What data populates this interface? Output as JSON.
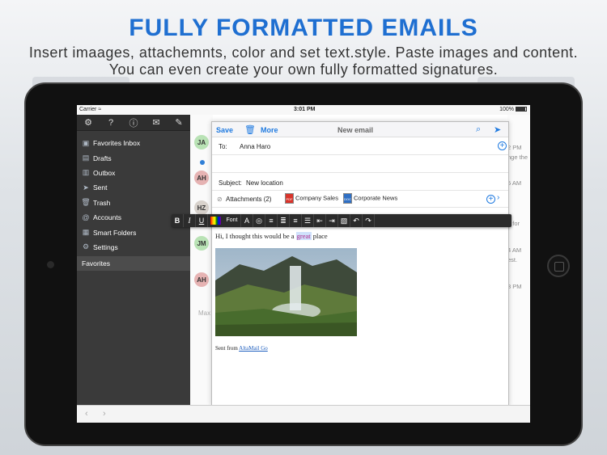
{
  "headline": "FULLY FORMATTED EMAILS",
  "subline": "Insert imaages, attachemnts, color and set text.style. Paste images and content. You can even create your own fully formatted signatures.",
  "status": {
    "carrier": "Carrier",
    "time": "3:01 PM",
    "battery": "100%"
  },
  "sidebar": {
    "toolbar_icons": [
      "gear-icon",
      "help-icon",
      "info-icon",
      "mail-icon",
      "compose-icon"
    ],
    "items": [
      {
        "label": "Favorites Inbox",
        "icon": "inbox-icon"
      },
      {
        "label": "Drafts",
        "icon": "drafts-icon"
      },
      {
        "label": "Outbox",
        "icon": "outbox-icon"
      },
      {
        "label": "Sent",
        "icon": "sent-icon"
      },
      {
        "label": "Trash",
        "icon": "trash-icon"
      },
      {
        "label": "Accounts",
        "icon": "at-icon"
      },
      {
        "label": "Smart Folders",
        "icon": "folder-icon"
      },
      {
        "label": "Settings",
        "icon": "gear-icon"
      }
    ],
    "favorites_label": "Favorites"
  },
  "message_list": {
    "avatars": [
      {
        "initials": "JA",
        "color": "#b9e2b5"
      },
      {
        "initials": "AH",
        "color": "#e6b3b3"
      },
      {
        "initials": "HZ",
        "color": "#d8d2cc"
      },
      {
        "initials": "JM",
        "color": "#b9e2b5"
      },
      {
        "initials": "AH",
        "color": "#e6b3b3"
      }
    ],
    "max_label": "Max"
  },
  "right_column": {
    "times": [
      "2 PM",
      "5 AM",
      "4 AM",
      "3 PM"
    ],
    "snippets": [
      "nge the",
      "d for",
      "est."
    ]
  },
  "compose": {
    "save_label": "Save",
    "more_label": "More",
    "title": "New email",
    "to_label": "To:",
    "to_value": "Anna Haro",
    "subject_label": "Subject:",
    "subject_value": "New location",
    "attachments_label": "Attachments (2)",
    "attachments": [
      {
        "name": "Company Sales",
        "type": "PDF",
        "color": "#d9342b"
      },
      {
        "name": "Corporate News",
        "type": "DOC",
        "color": "#2f6fc4"
      }
    ],
    "body_before": "Hi, I thought this would be a ",
    "body_selected": "great",
    "body_after": " place",
    "signature_prefix": "Sent from ",
    "signature_link": "AltaMail Go"
  },
  "format_bar": {
    "bold": "B",
    "italic": "I",
    "underline": "U",
    "font": "Font"
  },
  "colors": {
    "accent": "#1f7ae0",
    "headline": "#1f6fd1",
    "sidebar": "#3a3a3a"
  }
}
